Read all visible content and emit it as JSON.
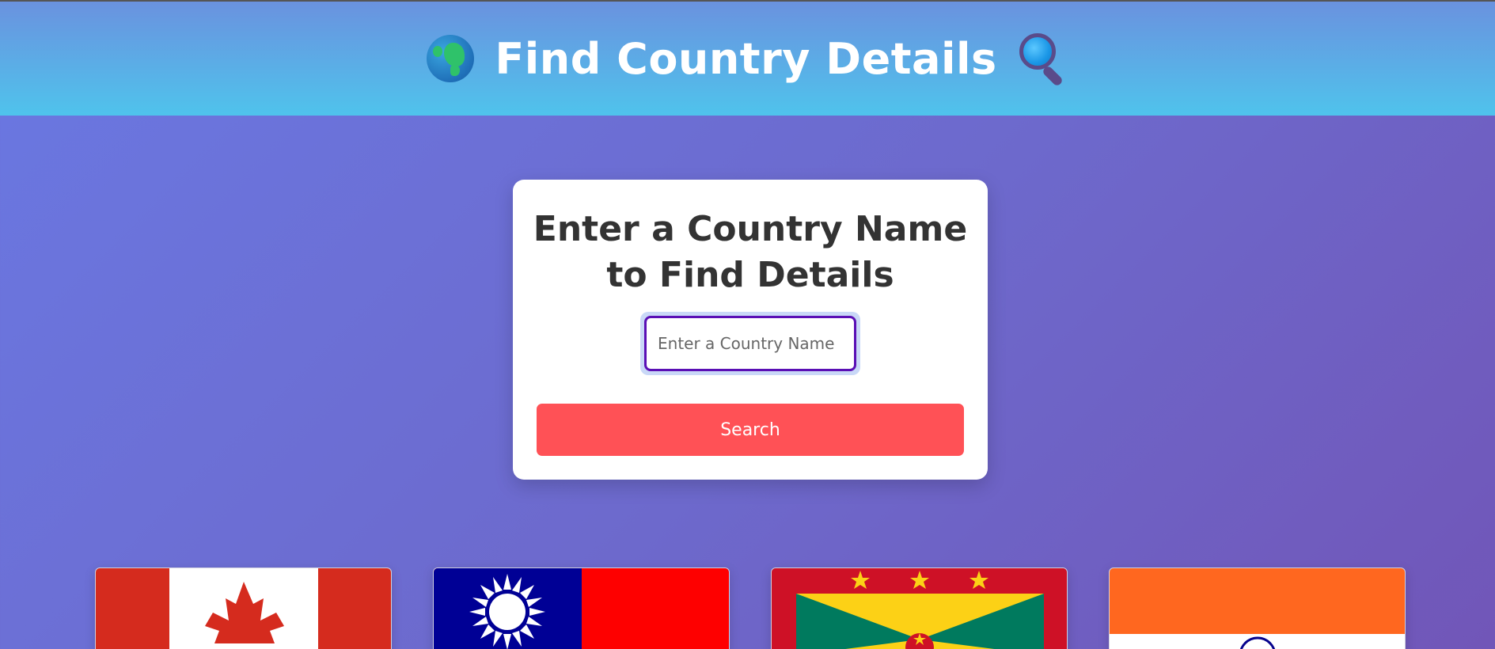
{
  "header": {
    "title": "Find Country Details",
    "left_icon": "globe-icon",
    "right_icon": "magnifier-icon"
  },
  "search_card": {
    "heading": "Enter a Country Name to Find Details",
    "input": {
      "placeholder": "Enter a Country Name",
      "value": ""
    },
    "button_label": "Search"
  },
  "flags": [
    {
      "country": "Canada",
      "icon": "canada-flag"
    },
    {
      "country": "Taiwan",
      "icon": "taiwan-flag"
    },
    {
      "country": "Grenada",
      "icon": "grenada-flag"
    },
    {
      "country": "India",
      "icon": "india-flag"
    }
  ],
  "colors": {
    "accent": "#ff5156",
    "input_border": "#5a0fb5",
    "header_top": "#6a92df",
    "header_bottom": "#4fc3ec"
  }
}
